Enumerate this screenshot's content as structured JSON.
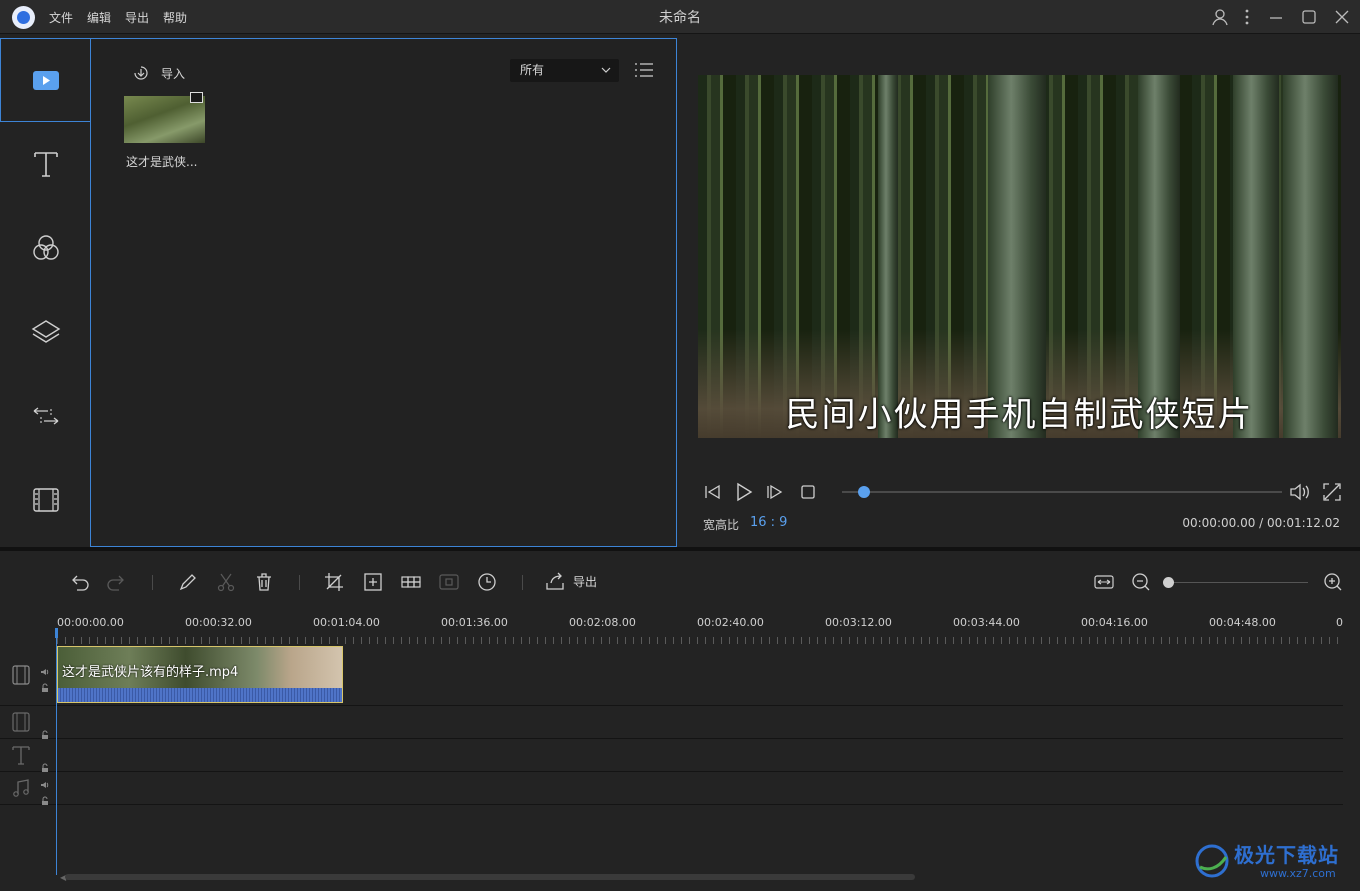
{
  "window": {
    "title": "未命名",
    "menu": [
      "文件",
      "编辑",
      "导出",
      "帮助"
    ]
  },
  "sidebar": {
    "items": [
      {
        "icon": "media-icon",
        "active": true
      },
      {
        "icon": "text-icon",
        "active": false
      },
      {
        "icon": "filter-icon",
        "active": false
      },
      {
        "icon": "overlay-icon",
        "active": false
      },
      {
        "icon": "transition-icon",
        "active": false
      },
      {
        "icon": "film-element-icon",
        "active": false
      }
    ]
  },
  "media": {
    "import_label": "导入",
    "filter_value": "所有",
    "items": [
      {
        "name": "这才是武侠..."
      }
    ]
  },
  "preview": {
    "subtitle": "民间小伙用手机自制武侠短片",
    "progress": 0.0,
    "aspect_label": "宽高比",
    "aspect_value": "16 : 9",
    "timecode": "00:00:00.00 / 00:01:12.02"
  },
  "toolbar": {
    "export_label": "导出"
  },
  "timeline": {
    "ruler_labels": [
      "00:00:00.00",
      "00:00:32.00",
      "00:01:04.00",
      "00:01:36.00",
      "00:02:08.00",
      "00:02:40.00",
      "00:03:12.00",
      "00:03:44.00",
      "00:04:16.00",
      "00:04:48.00",
      "0"
    ],
    "clip_name": "这才是武侠片该有的样子.mp4"
  },
  "watermark": {
    "name": "极光下载站",
    "url": "www.xz7.com"
  },
  "colors": {
    "accent": "#3d84d6",
    "progress": "#5aa0ee",
    "clip_border": "#d7c56a",
    "audio_wave": "#4f74c8"
  }
}
